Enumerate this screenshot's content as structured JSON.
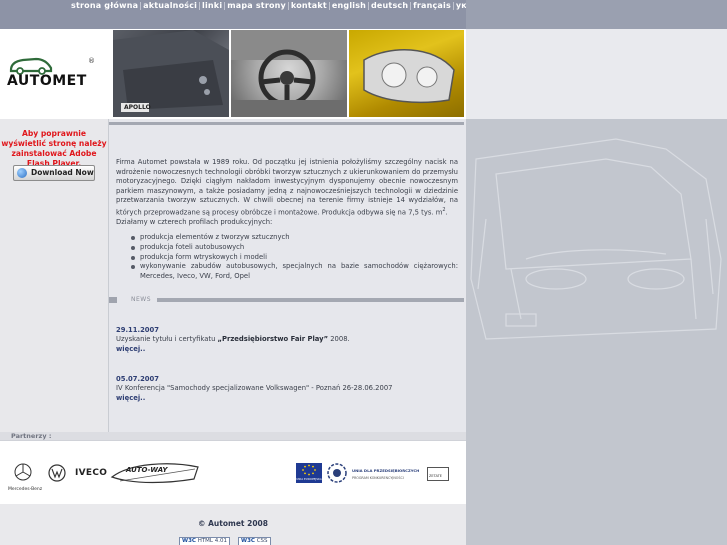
{
  "nav": {
    "items": [
      "strona główna",
      "aktualności",
      "linki",
      "mapa strony",
      "kontakt",
      "english",
      "deutsch",
      "français",
      "українська"
    ]
  },
  "header": {
    "logo_text": "AUTOMET",
    "logo_reg": "®",
    "photo1_caption": "APOLLO"
  },
  "flash": {
    "message": "Aby poprawnie wyświetlić stronę należy zainstalować Adobe Flash Player.",
    "download_label": "Download Now"
  },
  "intro": {
    "paragraph": "Firma Automet powstała w 1989 roku. Od początku jej istnienia położyliśmy szczególny nacisk na wdrożenie nowoczesnych technologii obróbki tworzyw sztucznych z ukierunkowaniem do przemysłu motoryzacyjnego. Dzięki ciągłym nakładom inwestycyjnym dysponujemy obecnie nowoczesnym parkiem maszynowym, a także posiadamy jedną z najnowocześniejszych technologii w dziedzinie przetwarzania tworzyw sztucznych. W chwili obecnej na terenie firmy istnieje 14 wydziałów, na których przeprowadzane są procesy obróbcze i montażowe. Produkcja odbywa się na 7,5 tys. m",
    "superscript": "2",
    "paragraph_end": ".",
    "profiles_intro": "Działamy w czterech profilach produkcyjnych:",
    "profiles": [
      "produkcja elementów z tworzyw sztucznych",
      "produkcja foteli autobusowych",
      "produkcja form wtryskowych i modeli",
      "wykonywanie zabudów autobusowych, specjalnych na bazie samochodów ciężarowych: Mercedes, Iveco, VW, Ford, Opel"
    ]
  },
  "news": {
    "label": "NEWS",
    "items": [
      {
        "date": "29.11.2007",
        "text_before": "Uzyskanie tytułu i certyfikatu ",
        "text_bold": "„Przedsiębiorstwo Fair Play”",
        "text_after": " 2008.",
        "more": "więcej.."
      },
      {
        "date": "05.07.2007",
        "text_before": "IV Konferencja \"Samochody specjalizowane Volkswagen\" - Poznań 26-28.06.2007",
        "text_bold": "",
        "text_after": "",
        "more": "więcej.."
      }
    ]
  },
  "partners": {
    "title": "Partnerzy :",
    "mercedes": "Mercedes-Benz",
    "iveco": "IVECO",
    "autoway": "AUTO-WAY",
    "eu_text": "UNIA EUROPEJSKA",
    "sector_line1": "UNIA DLA PRZEDSIĘBIORCZYCH",
    "sector_line2": "PROGRAM KONKURENCYJNOŚCI",
    "extra": "ZETATE"
  },
  "footer": {
    "copyright": "© Automet 2008",
    "badge1_w3": "W3C",
    "badge1_text": "HTML 4.01",
    "badge2_w3": "W3C",
    "badge2_text": "CSS"
  },
  "colors": {
    "nav_bg": "#8d93a6",
    "flash_red": "#e0161b",
    "link_blue": "#2e3e73"
  }
}
